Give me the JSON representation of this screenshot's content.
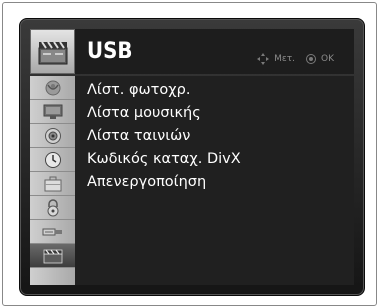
{
  "header": {
    "title": "USB",
    "icon": "usb-media-icon",
    "hints": [
      {
        "icon": "navigate-arrows-icon",
        "label": "Μετ."
      },
      {
        "icon": "ok-button-icon",
        "label": "OK"
      }
    ]
  },
  "sidebar": {
    "items": [
      {
        "icon": "satellite-dish-icon",
        "active": false
      },
      {
        "icon": "monitor-icon",
        "active": false
      },
      {
        "icon": "speaker-icon",
        "active": false
      },
      {
        "icon": "clock-icon",
        "active": false
      },
      {
        "icon": "briefcase-icon",
        "active": false
      },
      {
        "icon": "padlock-icon",
        "active": false
      },
      {
        "icon": "input-plug-icon",
        "active": false
      },
      {
        "icon": "usb-media-icon",
        "active": true
      }
    ]
  },
  "menu": {
    "items": [
      {
        "label": "Λίστ. φωτοχρ."
      },
      {
        "label": "Λίστα μουσικής"
      },
      {
        "label": "Λίστα ταινιών"
      },
      {
        "label": "Κωδικός καταχ. DivX"
      },
      {
        "label": "Απενεργοποίηση"
      }
    ]
  },
  "colors": {
    "panel_background": "#202020",
    "header_background": "#1d1d1d",
    "sidebar_background": "#bdbdbd",
    "text": "#ffffff",
    "hint_text": "#8a8a8a"
  }
}
